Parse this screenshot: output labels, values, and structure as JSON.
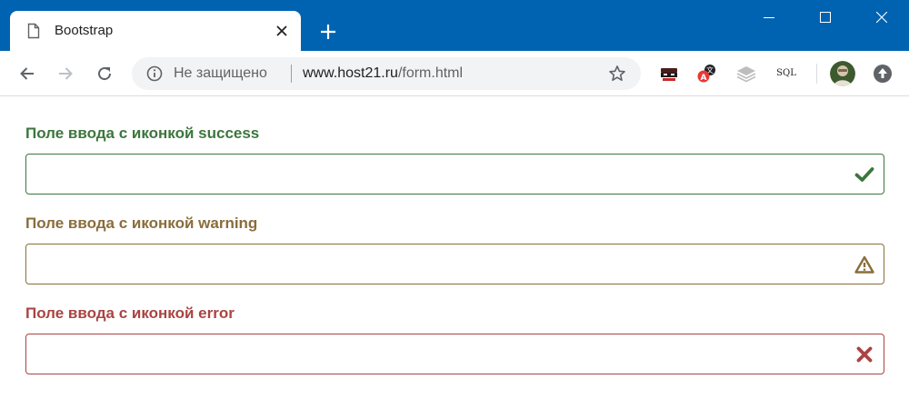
{
  "browser": {
    "tab": {
      "title": "Bootstrap"
    },
    "omnibox": {
      "security_label": "Не защищено",
      "url_host": "www.host21.ru",
      "url_path": "/form.html"
    },
    "extensions": {
      "sql_label": "SQL"
    }
  },
  "form": {
    "groups": [
      {
        "label": "Поле ввода с иконкой success",
        "value": "",
        "status": "success",
        "icon": "check-icon",
        "color": "#3c763d"
      },
      {
        "label": "Поле ввода с иконкой warning",
        "value": "",
        "status": "warning",
        "icon": "warning-icon",
        "color": "#8a6d3b"
      },
      {
        "label": "Поле ввода с иконкой error",
        "value": "",
        "status": "error",
        "icon": "cross-icon",
        "color": "#a94442"
      }
    ]
  },
  "colors": {
    "titlebar": "#0063b1",
    "success": "#3c763d",
    "warning": "#8a6d3b",
    "error": "#a94442"
  }
}
